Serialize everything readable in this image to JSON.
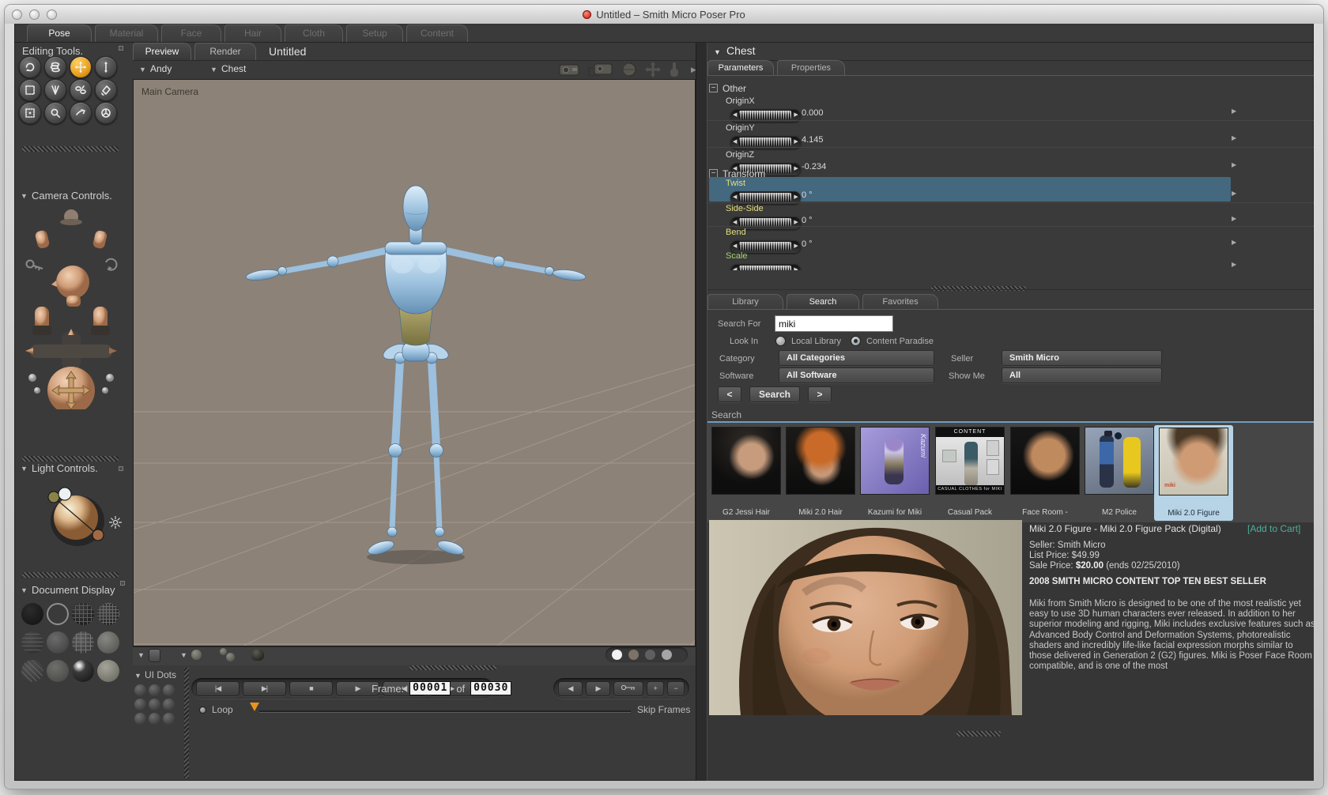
{
  "window": {
    "title": "Untitled – Smith Micro Poser Pro"
  },
  "main_tabs": [
    {
      "label": "Pose"
    },
    {
      "label": "Material"
    },
    {
      "label": "Face"
    },
    {
      "label": "Hair"
    },
    {
      "label": "Cloth"
    },
    {
      "label": "Setup"
    },
    {
      "label": "Content"
    }
  ],
  "editing_tools": {
    "title": "Editing Tools.",
    "tools": [
      "rotate",
      "twist",
      "translate-pull",
      "translate-in-out",
      "scale",
      "taper",
      "chain-break",
      "color",
      "morphing-tool",
      "zoom",
      "grouping-tool",
      "view-magnifier"
    ]
  },
  "camera_controls": {
    "title": "Camera Controls."
  },
  "light_controls": {
    "title": "Light Controls."
  },
  "document_display": {
    "title": "Document Display"
  },
  "document": {
    "view_tabs": [
      {
        "label": "Preview"
      },
      {
        "label": "Render"
      }
    ],
    "title": "Untitled",
    "figure_selector": "Andy",
    "actor_selector": "Chest",
    "camera_label": "Main Camera"
  },
  "timeline": {
    "ui_dots_label": "UI Dots",
    "frame_label": "Frame:",
    "current_frame": "00001",
    "of_label": "of",
    "total_frames": "00030",
    "loop_label": "Loop",
    "skip_frames_label": "Skip Frames"
  },
  "parameters_panel": {
    "title": "Chest",
    "tabs": [
      {
        "label": "Parameters"
      },
      {
        "label": "Properties"
      }
    ],
    "group_other": "Other",
    "group_transform": "Transform",
    "params": [
      {
        "label": "OriginX",
        "value": "0.000"
      },
      {
        "label": "OriginY",
        "value": "4.145"
      },
      {
        "label": "OriginZ",
        "value": "-0.234"
      },
      {
        "label": "Twist",
        "value": "0 °"
      },
      {
        "label": "Side-Side",
        "value": "0 °"
      },
      {
        "label": "Bend",
        "value": "0 °"
      },
      {
        "label": "Scale",
        "value": ""
      }
    ]
  },
  "library_panel": {
    "tabs": [
      {
        "label": "Library"
      },
      {
        "label": "Search"
      },
      {
        "label": "Favorites"
      }
    ],
    "search_for_label": "Search For",
    "search_value": "miki",
    "look_in_label": "Look In",
    "radios": [
      {
        "label": "Local Library",
        "selected": false
      },
      {
        "label": "Content Paradise",
        "selected": true
      }
    ],
    "category_label": "Category",
    "category_value": "All Categories",
    "seller_label": "Seller",
    "seller_value": "Smith Micro",
    "software_label": "Software",
    "software_value": "All Software",
    "show_me_label": "Show Me",
    "show_me_value": "All",
    "prev_label": "<",
    "search_button_label": "Search",
    "next_label": ">",
    "results_label": "Search"
  },
  "results": {
    "items": [
      {
        "caption": "G2 Jessi Hair"
      },
      {
        "caption": "Miki 2.0 Hair"
      },
      {
        "caption": "Kazumi for Miki",
        "overlay_side": "Kazumi"
      },
      {
        "caption": "Casual Pack",
        "overlay_top": "CONTENT",
        "overlay_bottom": "CASUAL CLOTHES for MIKI"
      },
      {
        "caption": "Face Room -"
      },
      {
        "caption": "M2 Police"
      },
      {
        "caption": "Miki 2.0 Figure",
        "selected": true
      }
    ]
  },
  "product": {
    "title": "Miki 2.0 Figure - Miki 2.0 Figure Pack (Digital)",
    "add_to_cart_label": "[Add to Cart]",
    "seller_line": "Seller: Smith Micro",
    "list_price_line": "List Price: $49.99",
    "sale_price_prefix": "Sale Price: ",
    "sale_price": "$20.00",
    "sale_price_suffix": " (ends 02/25/2010)",
    "banner": "2008 SMITH MICRO CONTENT TOP TEN BEST SELLER",
    "description": "Miki from Smith Micro is designed to be one of the most realistic yet easy to use 3D human characters ever released. In addition to her superior modeling and rigging, Miki includes exclusive features such as Advanced Body Control and Deformation Systems, photorealistic shaders and incredibly life-like facial expression morphs similar to those delivered in Generation 2 (G2) figures. Miki is Poser Face Room compatible, and is one of the most"
  },
  "colors": {
    "accent_orange": "#e8a020",
    "highlight_blue": "#44687e",
    "selected_thumb": "#b7d3e6",
    "link_teal": "#4fae9b",
    "viewport_bg": "#8c8278"
  }
}
